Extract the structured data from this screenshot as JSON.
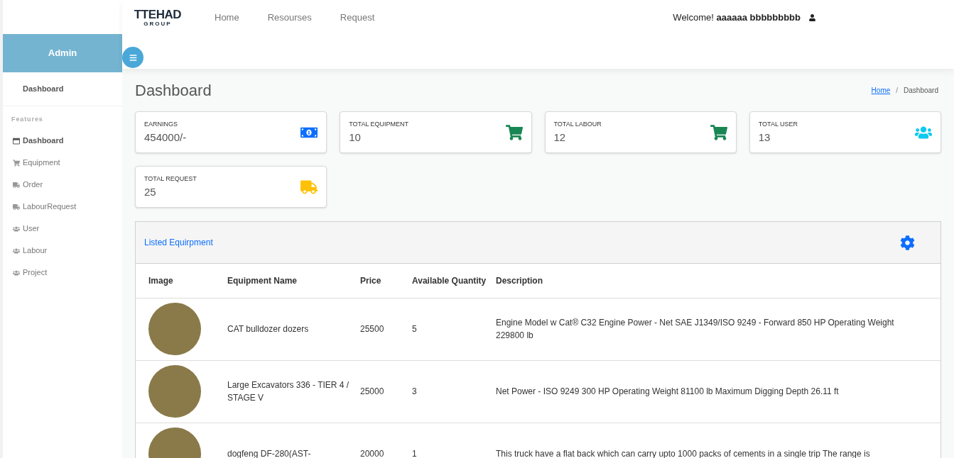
{
  "brand": {
    "name": "TTEHAD",
    "sub": "GROUP"
  },
  "nav": [
    {
      "label": "Home"
    },
    {
      "label": "Resourses"
    },
    {
      "label": "Request"
    }
  ],
  "welcome": {
    "greeting": "Welcome!",
    "user": "aaaaaa bbbbbbbbb"
  },
  "sidebar": {
    "title": "Admin",
    "top_item": {
      "label": "Dashboard"
    },
    "section": "Features",
    "items": [
      {
        "label": "Dashboard",
        "kind": "window",
        "selected": true
      },
      {
        "label": "Equipment",
        "kind": "cart",
        "selected": false
      },
      {
        "label": "Order",
        "kind": "truck",
        "selected": false
      },
      {
        "label": "LabourRequest",
        "kind": "truck",
        "selected": false
      },
      {
        "label": "User",
        "kind": "users",
        "selected": false
      },
      {
        "label": "Labour",
        "kind": "users",
        "selected": false
      },
      {
        "label": "Project",
        "kind": "users",
        "selected": false
      }
    ]
  },
  "page_title": "Dashboard",
  "breadcrumb_separator": "/",
  "breadcrumb": [
    {
      "label": "Home",
      "kind": "link"
    },
    {
      "label": "Dashboard",
      "kind": "current"
    }
  ],
  "stats": [
    {
      "label": "EARNINGS",
      "value": "454000/-",
      "kind": "money",
      "color": "#0d6efd"
    },
    {
      "label": "TOTAL EQUIPMENT",
      "value": "10",
      "kind": "cart",
      "color": "#198754"
    },
    {
      "label": "TOTAL LABOUR",
      "value": "12",
      "kind": "cart",
      "color": "#198754"
    },
    {
      "label": "TOTAL USER",
      "value": "13",
      "kind": "users",
      "color": "#0dcaf0"
    },
    {
      "label": "TOTAL REQUEST",
      "value": "25",
      "kind": "truck",
      "color": "#ffc107"
    }
  ],
  "table": {
    "title": "Listed Equirpment",
    "columns": [
      "Image",
      "Equipment Name",
      "Price",
      "Available Quantity",
      "Description"
    ],
    "rows": [
      {
        "name": "CAT bulldozer dozers",
        "price": "25500",
        "quantity": "5",
        "description": "Engine Model w Cat® C32 Engine Power - Net SAE J1349/ISO 9249 - Forward 850 HP Operating Weight 229800 lb"
      },
      {
        "name": "Large Excavators 336 - TIER 4 / STAGE V",
        "price": "25000",
        "quantity": "3",
        "description": "Net Power - ISO 9249 300 HP Operating Weight 81100 lb Maximum Digging Depth 26.11 ft"
      },
      {
        "name": "dogfeng DF-280(AST-",
        "price": "20000",
        "quantity": "1",
        "description": "This truck have a flat back which can carry upto 1000 packs of cements in a single trip The range is"
      }
    ]
  }
}
